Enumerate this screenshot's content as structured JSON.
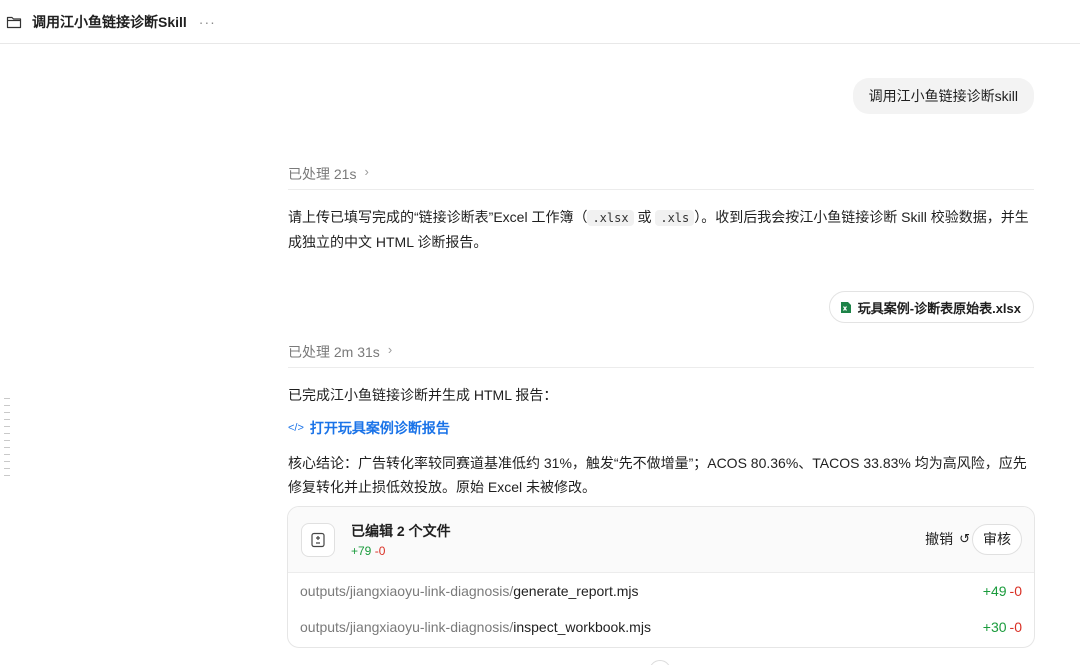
{
  "header": {
    "title": "调用江小鱼链接诊断Skill",
    "more": "···"
  },
  "messages": {
    "user1": "调用江小鱼链接诊断skill",
    "processed1": "已处理 21s",
    "reply1": {
      "before": "请上传已填写完成的“链接诊断表”Excel 工作簿（",
      "code1": ".xlsx",
      "mid": "或",
      "code2": ".xls",
      "after": "）。收到后我会按江小鱼链接诊断 Skill 校验数据，并生成独立的中文 HTML 诊断报告。"
    },
    "attachment": "玩具案例-诊断表原始表.xlsx",
    "processed2": "已处理 2m 31s",
    "reply2": "已完成江小鱼链接诊断并生成 HTML 报告：",
    "report_link": "打开玩具案例诊断报告",
    "conclusion": "核心结论：广告转化率较同赛道基准低约 31%，触发“先不做增量”；ACOS 80.36%、TACOS 33.83% 均为高风险，应先修复转化并止损低效投放。原始 Excel 未被修改。"
  },
  "edits": {
    "title": "已编辑 2 个文件",
    "added": "+79",
    "removed": "-0",
    "undo_label": "撤销",
    "review_label": "审核",
    "files": [
      {
        "dir": "outputs/jiangxiaoyu-link-diagnosis/",
        "name": "generate_report.mjs",
        "added": "+49",
        "removed": "-0"
      },
      {
        "dir": "outputs/jiangxiaoyu-link-diagnosis/",
        "name": "inspect_workbook.mjs",
        "added": "+30",
        "removed": "-0"
      }
    ]
  },
  "colors": {
    "link": "#1a73e8",
    "added": "#1a9b3c",
    "removed": "#d93025",
    "excel": "#1d8348"
  }
}
